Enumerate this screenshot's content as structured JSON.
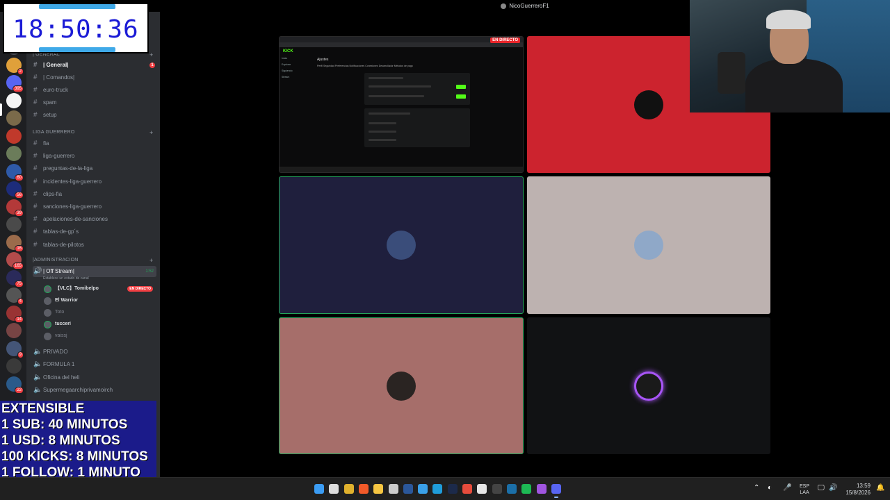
{
  "window": {
    "title": "NicoGuerreroF1"
  },
  "clock_overlay": {
    "time": "18:50:36"
  },
  "servers": [
    {
      "badge": ""
    },
    {
      "badge": "2"
    },
    {
      "badge": "395"
    },
    {
      "badge": ""
    },
    {
      "badge": ""
    },
    {
      "badge": ""
    },
    {
      "badge": ""
    },
    {
      "badge": "60"
    },
    {
      "badge": "56"
    },
    {
      "badge": "39"
    },
    {
      "badge": ""
    },
    {
      "badge": "16"
    },
    {
      "badge": "165"
    },
    {
      "badge": "75"
    },
    {
      "badge": "4"
    },
    {
      "badge": "14"
    },
    {
      "badge": ""
    },
    {
      "badge": "9"
    },
    {
      "badge": ""
    },
    {
      "badge": "22"
    }
  ],
  "sidebar": {
    "categories": {
      "general": "| GENERAL",
      "liga": "LIGA GUERRERO",
      "admin": "|ADMINISTRACION"
    },
    "general_channels": [
      {
        "label": "| General|",
        "mention": "1"
      },
      {
        "label": "| Comandos|",
        "mention": ""
      },
      {
        "label": "euro-truck",
        "mention": ""
      },
      {
        "label": "spam",
        "mention": ""
      },
      {
        "label": "setup",
        "mention": ""
      }
    ],
    "liga_channels": [
      "fia",
      "liga-guerrero",
      "preguntas-de-la-liga",
      "incidentes-liga-guerrero",
      "clips-fia",
      "sanciones-liga-guerrero",
      "apelaciones-de-sanciones",
      "tablas-de-gp´s",
      "tablas-de-pilotos"
    ],
    "voice_channel": {
      "label": "| Off Stream|",
      "timer": "1:52",
      "status_hint": "Establece un estado de canal",
      "users": [
        {
          "name": "【VLC】Tomibelpo",
          "live": "EN DIRECTO"
        },
        {
          "name": "El Warrior",
          "live": ""
        },
        {
          "name": "Toto",
          "live": ""
        },
        {
          "name": "tucceri",
          "live": ""
        },
        {
          "name": "vaissj",
          "live": ""
        }
      ]
    },
    "other_voice": [
      "PRIVADO",
      "FORMULA 1",
      "Oficina del heli",
      "Supermegaarchiprivamoirch"
    ]
  },
  "subathon": {
    "lines": [
      "EXTENSIBLE",
      "1 SUB: 40 MINUTOS",
      "1 USD: 8 MINUTOS",
      "100 KICKS: 8 MINUTOS",
      "1 FOLLOW: 1 MINUTO"
    ]
  },
  "stream": {
    "live_badge": "EN DIRECTO",
    "share": {
      "logo": "KICK",
      "nav": [
        "Inicio",
        "Explorar",
        "Siguiendo",
        "Stream"
      ],
      "page_title": "Ajustes",
      "tabs": "Perfil   Seguridad   Preferencias   Notificaciones   Conexiones   Desarrollador   Métodos de pago"
    },
    "tile_colors": {
      "red": "#cc232e",
      "navy": "#1f1f3d",
      "silver": "#bdb2b0",
      "rose": "#a66e6a",
      "dark": "#111214"
    }
  },
  "taskbar": {
    "lang": [
      "ESP",
      "LAA"
    ],
    "time": "13:59",
    "date": "15/8/2026"
  }
}
